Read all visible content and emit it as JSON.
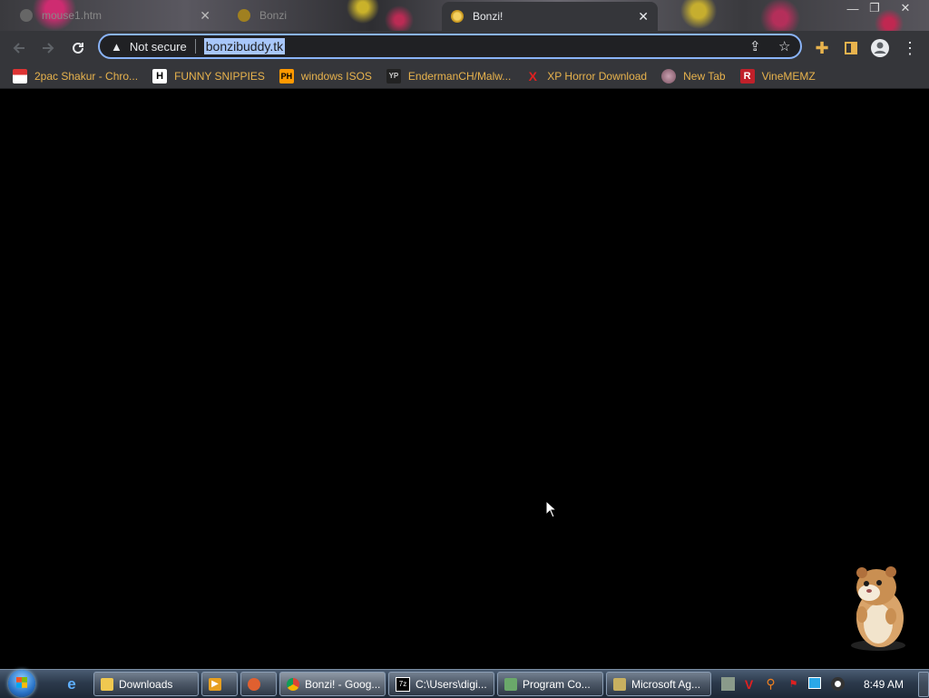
{
  "browser": {
    "tabs": [
      {
        "title": "mouse1.htm",
        "active": false
      },
      {
        "title": "Bonzi",
        "active": false
      },
      {
        "title": "Bonzi!",
        "active": true
      }
    ],
    "close_glyph": "✕",
    "window_controls": {
      "minimize": "—",
      "restore": "❐",
      "close": "✕"
    }
  },
  "toolbar": {
    "security_label": "Not secure",
    "url": "bonzibuddy.tk"
  },
  "bookmarks": [
    {
      "label": "2pac Shakur - Chro...",
      "icon": "bookmark-2pac-icon",
      "glyph": ""
    },
    {
      "label": "FUNNY SNIPPIES",
      "icon": "bookmark-h-icon",
      "glyph": "H"
    },
    {
      "label": "windows ISOS",
      "icon": "bookmark-ph-icon",
      "glyph": "PH"
    },
    {
      "label": "EndermanCH/Malw...",
      "icon": "bookmark-yp-icon",
      "glyph": "YP"
    },
    {
      "label": "XP Horror Download",
      "icon": "bookmark-x-icon",
      "glyph": "X"
    },
    {
      "label": "New Tab",
      "icon": "bookmark-globe-icon",
      "glyph": ""
    },
    {
      "label": "VineMEMZ",
      "icon": "bookmark-r-icon",
      "glyph": "R"
    }
  ],
  "taskbar": {
    "tasks": [
      {
        "label": "Downloads",
        "icon": "folder-icon"
      },
      {
        "label": "",
        "icon": "media-player-icon"
      },
      {
        "label": "",
        "icon": "app-icon"
      },
      {
        "label": "Bonzi! - Goog...",
        "icon": "chrome-icon"
      },
      {
        "label": "C:\\Users\\digi...",
        "icon": "7zip-icon"
      },
      {
        "label": "Program Co...",
        "icon": "control-panel-icon"
      },
      {
        "label": "Microsoft Ag...",
        "icon": "agent-icon"
      }
    ],
    "clock": "8:49 AM"
  },
  "colors": {
    "accent": "#8ab4f8",
    "bookmark_text": "#e8b34d",
    "url_highlight": "#a8c7fa"
  }
}
